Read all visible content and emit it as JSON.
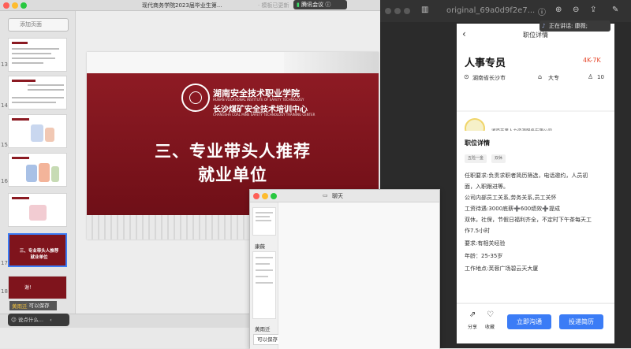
{
  "keynote": {
    "window_title": "现代商务学院2023届毕业生第...",
    "window_title_suffix": "· 模板已更新",
    "meeting_app": "腾讯会议",
    "add_slide": "添加页面",
    "slide_numbers": [
      "13",
      "14",
      "15",
      "16",
      "17",
      "18"
    ],
    "current_slide": {
      "school_cn": "湖南安全技术职业学院",
      "school_en": "HUNAN VOCATIONAL INSTITUTE OF SAFETY TECHNOLOGY",
      "center_cn": "长沙煤矿安全技术培训中心",
      "center_en": "CHANGSHA COAL MINE SAFETY TECHNOLOGY TRAINING CENTER",
      "title_line1": "三、专业带头人推荐",
      "title_line2": "就业单位"
    },
    "thumb17_line1": "三、专业带头人推荐",
    "thumb17_line2": "就业单位",
    "thumb18_text": "谢！"
  },
  "preview": {
    "filename": "original_69a0d9f2e7...",
    "speaking": "正在讲话: 康薇;",
    "phone": {
      "header_title": "职位详情",
      "job_title": "人事专员",
      "salary": "4K-7K",
      "location": "湖南省长沙市",
      "education": "大专",
      "headcount": "10",
      "company": "湖南芒果人力资源服务有限公司",
      "detail_title": "职位详情",
      "tags": [
        "五险一金",
        "双休"
      ],
      "requirements": [
        "任职要求:负责求职者简历筛选，电话邀约，人员初",
        "面，入职跟进等。",
        "公司内部员工关系,劳务关系,员工关怀",
        "工资待遇:3000底薪➕600绩效➕提成",
        "双休，社保，节假日福利齐全，不定时下午茶每天工",
        "作7.5小时",
        "要求:有相关经验",
        "年龄：25-35岁",
        "工作地点:芙蓉广场碧云天大厦"
      ],
      "share": "分享",
      "favorite": "收藏",
      "contact_button": "立即沟通",
      "resume_button": "投递简历"
    }
  },
  "chat": {
    "title": "聊天",
    "name1": "康薇",
    "name2": "黄雨迁",
    "save_button": "可以保存",
    "notice_name": "黄雨迁",
    "notice_text": "可以保存",
    "input_placeholder": "说点什么..."
  },
  "colors": {
    "slide_red": "#8e1b24",
    "salary": "#e64a2e",
    "button_blue": "#3b7cf6"
  }
}
